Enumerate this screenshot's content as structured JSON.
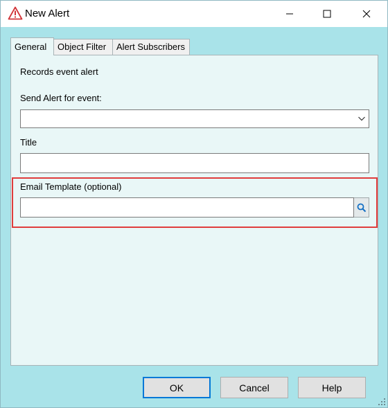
{
  "window": {
    "title": "New Alert",
    "icon": "warning-triangle-icon"
  },
  "tabs": [
    {
      "label": "General",
      "active": true
    },
    {
      "label": "Object Filter",
      "active": false
    },
    {
      "label": "Alert Subscribers",
      "active": false
    }
  ],
  "form": {
    "description": "Records event alert",
    "send_alert_label": "Send Alert for event:",
    "send_alert_value": "",
    "title_label": "Title",
    "title_value": "",
    "email_template_label": "Email Template (optional)",
    "email_template_value": "",
    "lookup_icon": "search-icon"
  },
  "buttons": {
    "ok": "OK",
    "cancel": "Cancel",
    "help": "Help"
  },
  "colors": {
    "dialog_background": "#a9e3e9",
    "panel_background": "#e9f7f7",
    "highlight_border": "#e03c3c",
    "default_button_border": "#0078d7"
  }
}
